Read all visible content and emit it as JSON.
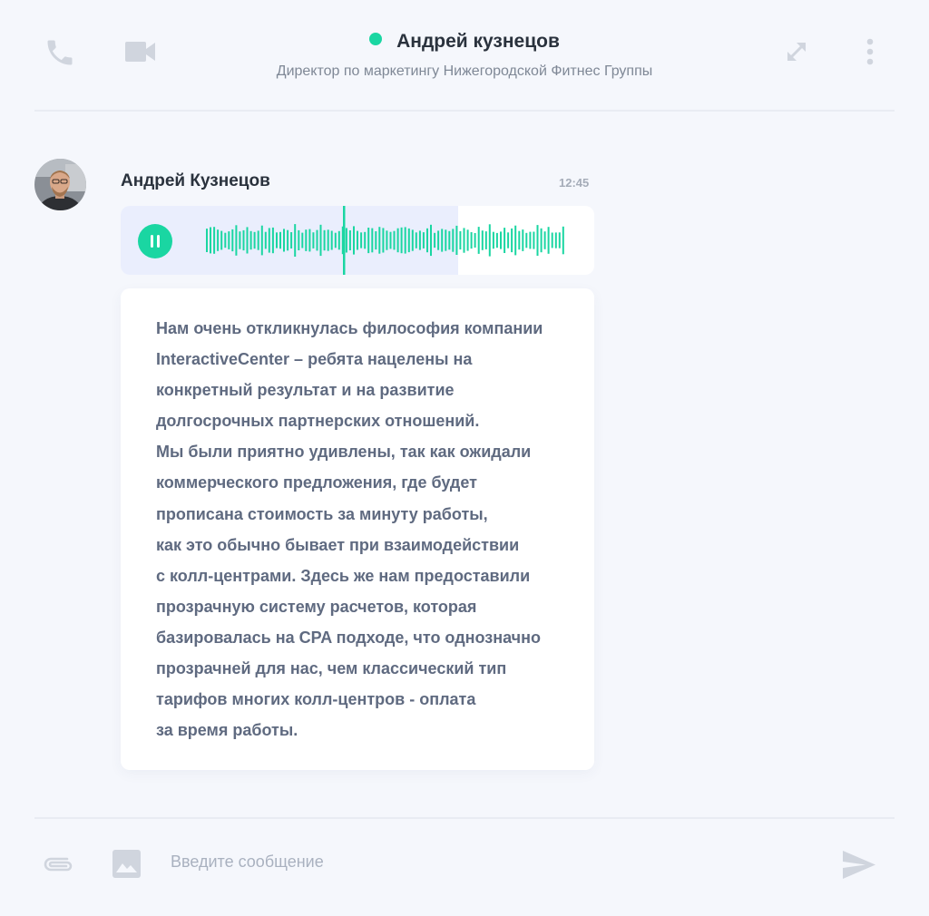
{
  "header": {
    "contact_name": "Андрей кузнецов",
    "contact_title": "Директор по маркетингу Нижегородской Фитнес Группы",
    "status_color": "#1ad6a2",
    "icons": [
      "phone-icon",
      "video-camera-icon",
      "expand-icon",
      "more-vertical-icon"
    ]
  },
  "message": {
    "sender": "Андрей Кузнецов",
    "time": "12:45",
    "voice": {
      "state": "playing",
      "progress": 0.62
    },
    "text_lines": [
      "Нам очень откликнулась философия компании",
      "InteractiveCenter – ребята нацелены на",
      "конкретный результат и на развитие",
      "долгосрочных партнерских отношений.",
      "Мы были приятно удивлены, так как ожидали",
      "коммерческого предложения, где будет",
      "прописана стоимость за минуту работы,",
      "как это обычно бывает при взаимодействии",
      "с колл-центрами. Здесь же нам предоставили",
      "прозрачную систему расчетов, которая",
      "базировалась на CPA подходе, что однозначно",
      "прозрачней для нас,  чем классический тип",
      "тарифов многих колл-центров - оплата",
      "за время работы."
    ]
  },
  "composer": {
    "placeholder": "Введите сообщение",
    "icons": [
      "paperclip-icon",
      "image-icon",
      "send-icon"
    ]
  },
  "colors": {
    "accent": "#1ad6a2",
    "icon_gray": "#d0d5de",
    "text_dark": "#2a323d",
    "text_body": "#5f6a80",
    "background": "#f5f7fc"
  }
}
